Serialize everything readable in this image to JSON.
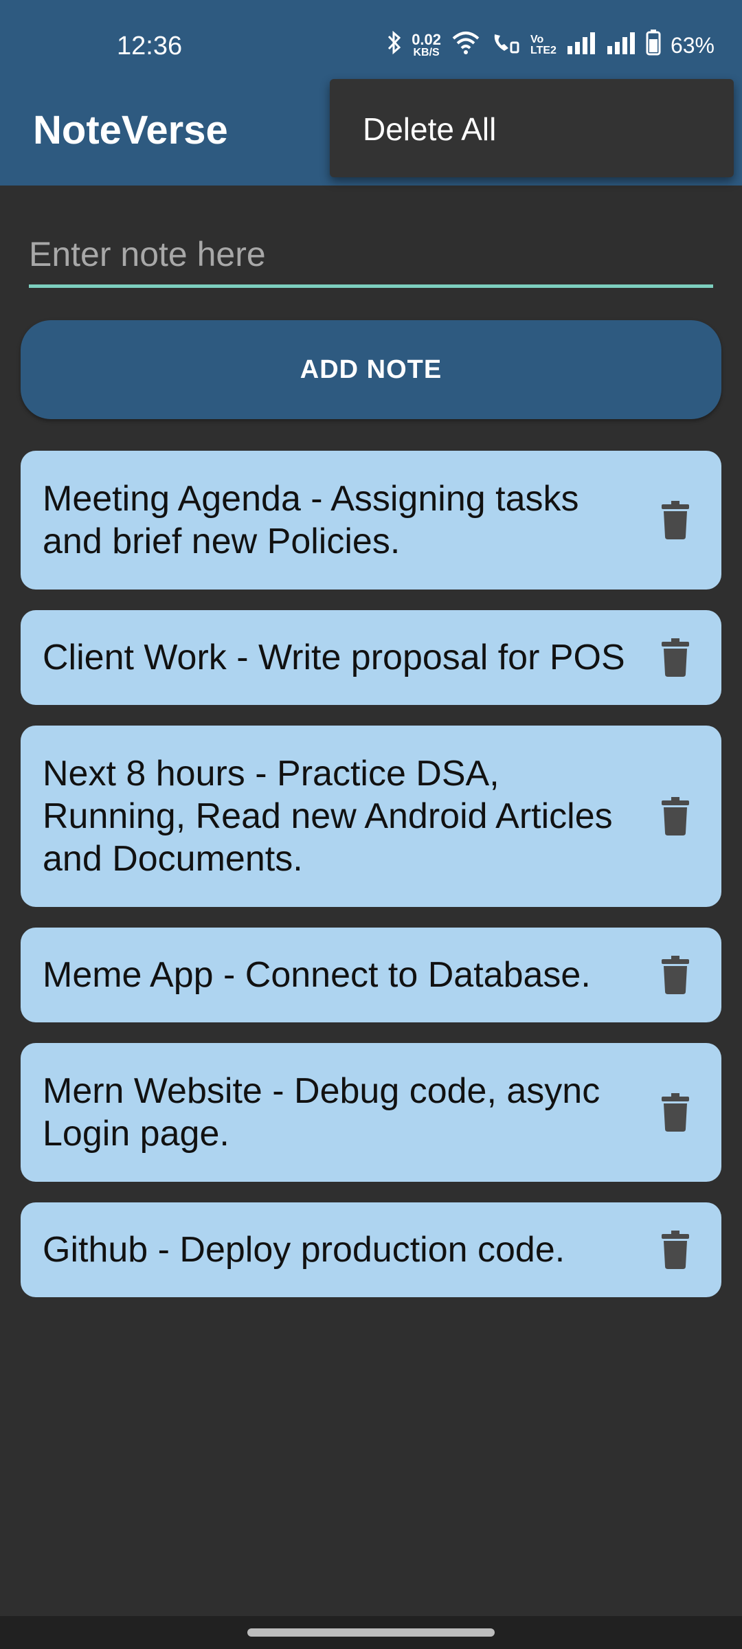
{
  "status_bar": {
    "time": "12:36",
    "speed_value": "0.02",
    "speed_unit": "KB/S",
    "volte_top": "Vo",
    "volte_bottom": "LTE2",
    "battery": "63%",
    "icons": [
      "bluetooth-icon",
      "wifi-icon",
      "wifi-calling-icon",
      "volte-icon",
      "signal-icon",
      "signal-icon",
      "battery-icon"
    ]
  },
  "app_bar": {
    "title": "NoteVerse"
  },
  "overflow_menu": {
    "items": [
      {
        "label": "Delete All"
      }
    ]
  },
  "note_input": {
    "placeholder": "Enter note here",
    "value": ""
  },
  "add_button": {
    "label": "ADD NOTE"
  },
  "notes": [
    {
      "text": "Meeting Agenda - Assigning tasks and brief new Policies.",
      "icon": "trash-icon"
    },
    {
      "text": "Client Work - Write proposal for POS",
      "icon": "trash-icon"
    },
    {
      "text": "Next 8 hours - Practice DSA, Running, Read new Android Articles and Documents.",
      "icon": "trash-icon"
    },
    {
      "text": "Meme App - Connect to Database.",
      "icon": "trash-icon"
    },
    {
      "text": "Mern Website - Debug code, async Login page.",
      "icon": "trash-icon"
    },
    {
      "text": "Github - Deploy production code.",
      "icon": "trash-icon"
    }
  ],
  "colors": {
    "primary": "#2e5a80",
    "background": "#2f2f2f",
    "note_card": "#aed4f0",
    "input_underline": "#7dcfbf",
    "menu_bg": "#333333"
  }
}
